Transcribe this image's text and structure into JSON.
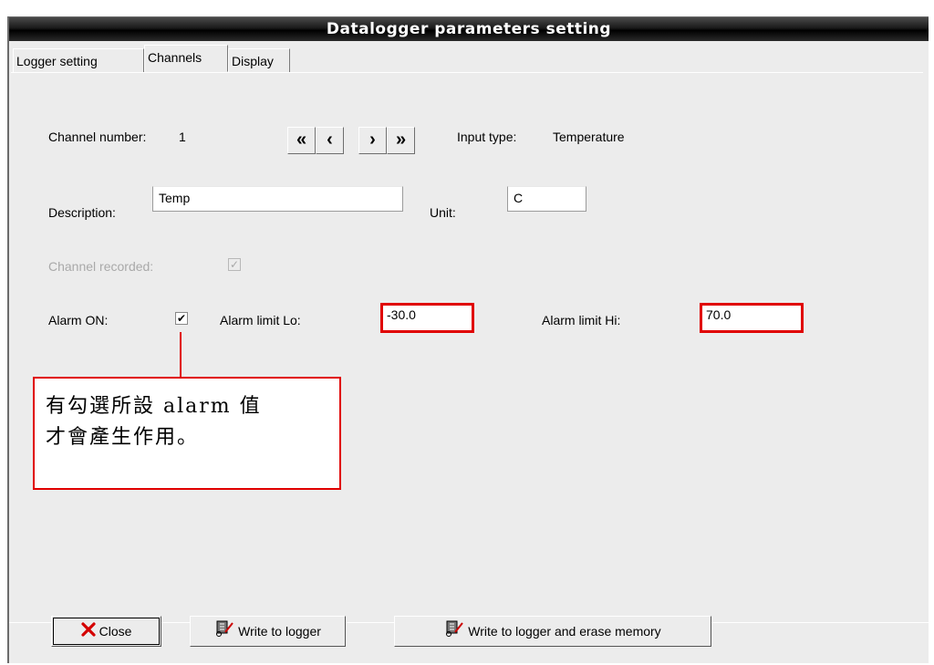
{
  "window": {
    "title": "Datalogger parameters setting"
  },
  "tabs": [
    {
      "label": "Logger setting"
    },
    {
      "label": "Channels"
    },
    {
      "label": "Display"
    }
  ],
  "channel": {
    "number_label": "Channel number:",
    "number_value": "1",
    "input_type_label": "Input type:",
    "input_type_value": "Temperature",
    "nav": [
      "«",
      "‹",
      "›",
      "»"
    ]
  },
  "fields": {
    "description_label": "Description:",
    "description_value": "Temp",
    "unit_label": "Unit:",
    "unit_value": "C",
    "channel_recorded_label": "Channel recorded:",
    "alarm_on_label": "Alarm ON:",
    "alarm_lo_label": "Alarm limit Lo:",
    "alarm_lo_value": "-30.0",
    "alarm_hi_label": "Alarm limit Hi:",
    "alarm_hi_value": "70.0"
  },
  "callout": {
    "line1": "有勾選所設 alarm 值",
    "line2": "才會產生作用。"
  },
  "buttons": {
    "close": "Close",
    "write": "Write to logger",
    "write_erase": "Write to logger and erase memory"
  },
  "colors": {
    "highlight": "#e00000",
    "title_bg": "#000000"
  }
}
